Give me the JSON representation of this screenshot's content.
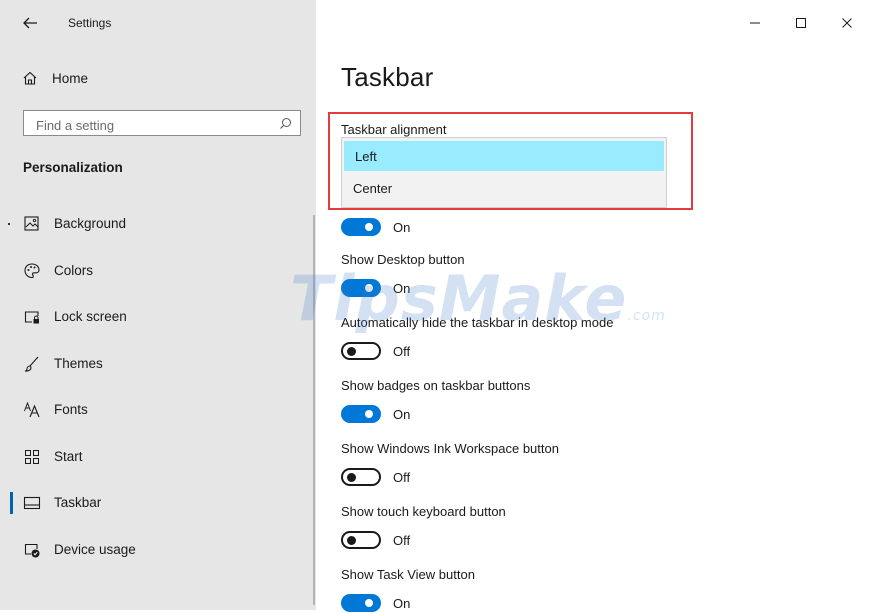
{
  "app": {
    "title": "Settings"
  },
  "sidebar": {
    "home_label": "Home",
    "search_placeholder": "Find a setting",
    "section_title": "Personalization",
    "items": [
      {
        "label": "Background",
        "icon": "image-icon"
      },
      {
        "label": "Colors",
        "icon": "palette-icon"
      },
      {
        "label": "Lock screen",
        "icon": "lock-screen-icon"
      },
      {
        "label": "Themes",
        "icon": "brush-icon"
      },
      {
        "label": "Fonts",
        "icon": "fonts-icon"
      },
      {
        "label": "Start",
        "icon": "start-icon"
      },
      {
        "label": "Taskbar",
        "icon": "taskbar-icon",
        "active": true
      },
      {
        "label": "Device usage",
        "icon": "device-usage-icon"
      }
    ]
  },
  "main": {
    "page_title": "Taskbar",
    "alignment": {
      "label": "Taskbar alignment",
      "options": [
        "Left",
        "Center"
      ],
      "selected": "Left"
    },
    "toggles": [
      {
        "label": "",
        "state": "On",
        "on": true
      },
      {
        "label": "Show Desktop button",
        "state": "On",
        "on": true
      },
      {
        "label": "Automatically hide the taskbar in desktop mode",
        "state": "Off",
        "on": false
      },
      {
        "label": "Show badges on taskbar buttons",
        "state": "On",
        "on": true
      },
      {
        "label": "Show Windows Ink Workspace button",
        "state": "Off",
        "on": false
      },
      {
        "label": "Show touch keyboard button",
        "state": "Off",
        "on": false
      },
      {
        "label": "Show Task View button",
        "state": "On",
        "on": true
      }
    ]
  },
  "watermark": {
    "text": "TipsMake",
    "suffix": ".com"
  },
  "colors": {
    "accent": "#0078d7",
    "highlight_border": "#e43a3a",
    "selected_option": "#99ebff"
  }
}
